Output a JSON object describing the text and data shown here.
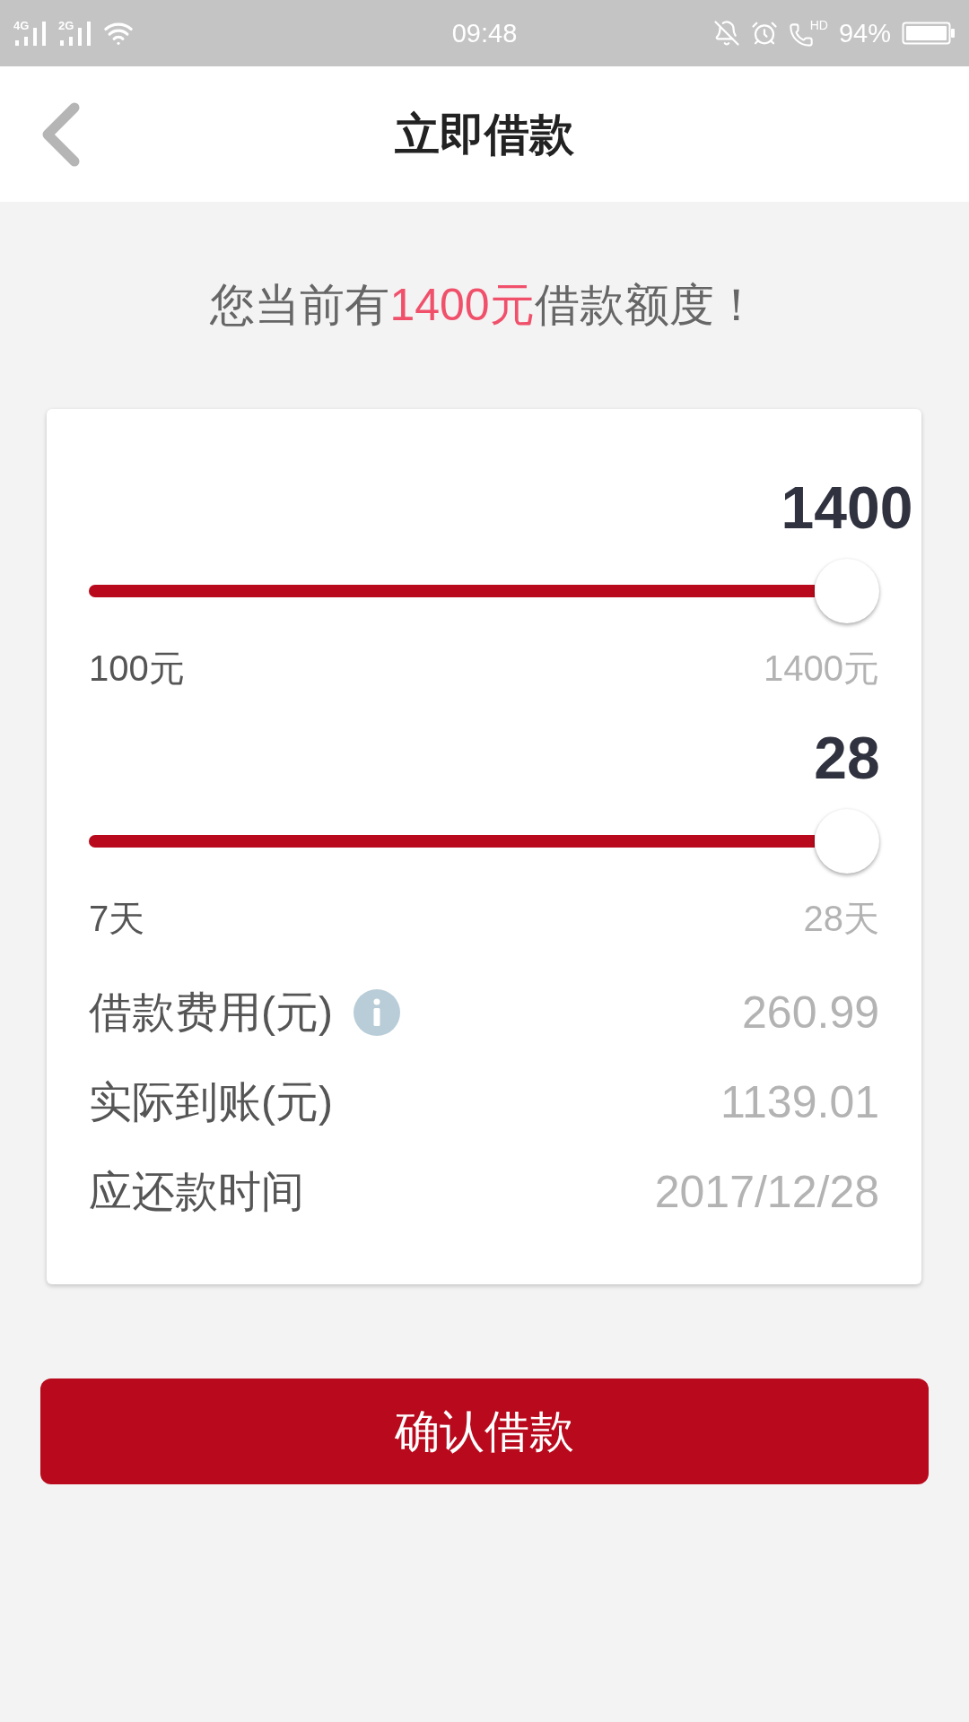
{
  "status_bar": {
    "signals": [
      {
        "label": "4G"
      },
      {
        "label": "2G"
      }
    ],
    "time": "09:48",
    "call_badge": "HD",
    "battery": "94%"
  },
  "header": {
    "title": "立即借款"
  },
  "quota_message": {
    "before": "您当前有",
    "highlight": "1400元",
    "after": "借款额度！"
  },
  "sliders": [
    {
      "value": "1400",
      "level": 1,
      "min_label": "100元",
      "max_label": "1400元"
    },
    {
      "value": "28",
      "level": 1,
      "min_label": "7天",
      "max_label": "28天"
    }
  ],
  "details": [
    {
      "label": "借款费用(元)",
      "info": true,
      "value": "260.99"
    },
    {
      "label": "实际到账(元)",
      "info": false,
      "value": "1139.01"
    },
    {
      "label": "应还款时间",
      "info": false,
      "value": "2017/12/28"
    }
  ],
  "confirm_button": {
    "label": "确认借款"
  }
}
